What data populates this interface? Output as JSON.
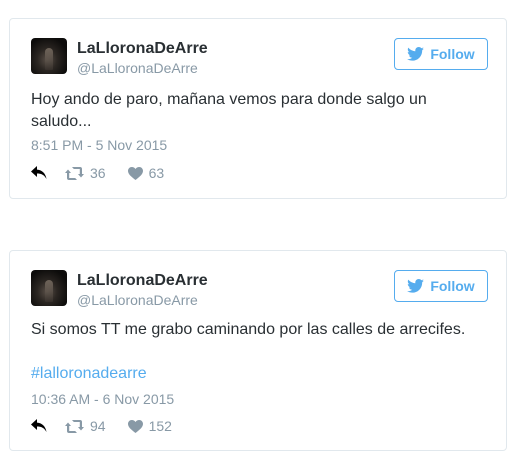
{
  "tweets": [
    {
      "name": "LaLloronaDeArre",
      "handle": "@LaLloronaDeArre",
      "follow_label": "Follow",
      "text": "Hoy ando de paro, mañana vemos para donde salgo un saludo...",
      "hashtag": "",
      "timestamp": "8:51 PM - 5 Nov 2015",
      "retweets": "36",
      "likes": "63"
    },
    {
      "name": "LaLloronaDeArre",
      "handle": "@LaLloronaDeArre",
      "follow_label": "Follow",
      "text": "Si somos TT me grabo caminando por las calles de arrecifes.",
      "hashtag": "#lalloronadearre",
      "timestamp": "10:36 AM - 6 Nov 2015",
      "retweets": "94",
      "likes": "152"
    }
  ],
  "icons": {
    "follow": "twitter-bird-icon",
    "reply": "reply-icon",
    "retweet": "retweet-icon",
    "like": "heart-icon"
  },
  "colors": {
    "accent": "#55acee",
    "text": "#292f33",
    "muted": "#8899a6",
    "border": "#e1e8ed"
  }
}
